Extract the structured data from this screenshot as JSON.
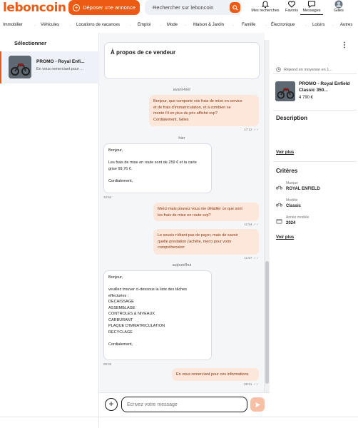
{
  "header": {
    "logo": "leboncoin",
    "post_ad_label": "Déposer une annonce",
    "search_placeholder": "Rechercher sur leboncoin",
    "nav": [
      {
        "label": "Mes recherches",
        "icon": "bell-icon"
      },
      {
        "label": "Favoris",
        "icon": "heart-icon"
      },
      {
        "label": "Messages",
        "icon": "message-icon"
      },
      {
        "label": "Gilles",
        "icon": "avatar"
      }
    ]
  },
  "categories": [
    "Immobilier",
    "Véhicules",
    "Locations de vacances",
    "Emploi",
    "Mode",
    "Maison & Jardin",
    "Famille",
    "Électronique",
    "Loisirs",
    "Autres"
  ],
  "left": {
    "header": "Sélectionner",
    "conversation": {
      "title": "PROMO - Royal Enfi...",
      "preview": "En vous remerciant pour ..."
    }
  },
  "chat": {
    "seller_card": "À propos de ce vendeur",
    "messages": [
      {
        "type": "day",
        "text": "avant-hier"
      },
      {
        "type": "me",
        "text": "Bonjour, que comporte vos frais de mise en service\net de frais d'immatriculation, et à combien se\nmonte t'il en plus du prix affiché svp?\nCordialement, Gilles",
        "time": "17:12"
      },
      {
        "type": "day",
        "text": "hier"
      },
      {
        "type": "them",
        "text": "Bonjour,\n\nLes frais de mise en route sont de 259 € et la carte\ngrise 99,76 €.\n\nCordialement,",
        "time": "10:54"
      },
      {
        "type": "me",
        "text": "Merci mais pouvez vous me détailler ce que sont\nles frais de mise en route svp?",
        "time": "11:54"
      },
      {
        "type": "me",
        "text": "Le soucis n'étant pas de payer, mais de savoir\nquelle prestation j'achète, merci pour votre\ncompréhension",
        "time": "11:57"
      },
      {
        "type": "day",
        "text": "aujourd'hui"
      },
      {
        "type": "them",
        "text": "Bonjour,\n\nveuillez trouver ci-dessous la liste des tâches\neffectuées :\nDECAISSAGE\nASSEMBLAGE\nCONTROLES & NIVEAUX\nCARBURANT\nPLAQUE D'IMMATRICULATION\nRECYCLAGE\n\nCordialement,",
        "time": "09:32"
      },
      {
        "type": "me",
        "text": "En vous remerciant pour ces informations",
        "time": "09:01"
      }
    ]
  },
  "composer": {
    "placeholder": "Écrivez votre message"
  },
  "right": {
    "response_time": "Répond en moyenne en 1...",
    "ad": {
      "title": "PROMO - Royal Enfield Classic 350...",
      "price": "4 790 €"
    },
    "description_title": "Description",
    "see_more_1": "Voir plus",
    "criteria_title": "Critères",
    "criteria": [
      {
        "key": "Marque",
        "value": "ROYAL ENFIELD",
        "icon": "motorbike-icon"
      },
      {
        "key": "Modèle",
        "value": "Classic",
        "icon": "motorbike-icon"
      },
      {
        "key": "Année modèle",
        "value": "2024",
        "icon": "calendar-icon"
      }
    ],
    "see_more_2": "Voir plus"
  },
  "colors": {
    "brand": "#ec5a13",
    "bubble_me": "#fde6da",
    "bubble_me_text": "#8a3710"
  }
}
